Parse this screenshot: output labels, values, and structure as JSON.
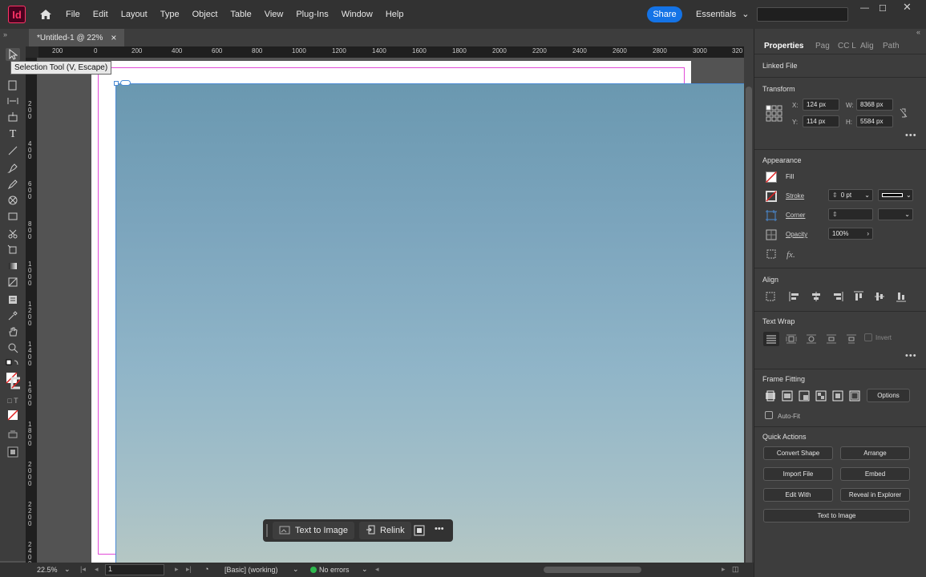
{
  "app": {
    "logo_text": "Id"
  },
  "menu": [
    "File",
    "Edit",
    "Layout",
    "Type",
    "Object",
    "Table",
    "View",
    "Plug-Ins",
    "Window",
    "Help"
  ],
  "header": {
    "share_label": "Share",
    "workspace_label": "Essentials"
  },
  "document": {
    "tab_title": "*Untitled-1 @ 22%",
    "close_glyph": "×"
  },
  "tooltip": "Selection Tool (V, Escape)",
  "ruler": {
    "h_labels": [
      "200",
      "0",
      "200",
      "400",
      "600",
      "800",
      "1000",
      "1200",
      "1400",
      "1600",
      "1800",
      "2000",
      "2200",
      "2400",
      "2600",
      "2800",
      "3000",
      "320"
    ],
    "v_labels": [
      "2 0 0",
      "4 0 0",
      "6 0 0",
      "8 0 0",
      "1 0 0 0",
      "1 2 0 0",
      "1 4 0 0",
      "1 6 0 0",
      "1 8 0 0",
      "2 0 0 0",
      "2 2 0 0",
      "2 4 0 0"
    ]
  },
  "context_bar": {
    "text_to_image": "Text to Image",
    "relink": "Relink",
    "more": "•••"
  },
  "status": {
    "zoom": "22.5%",
    "page": "1",
    "style": "[Basic] (working)",
    "errors": "No errors"
  },
  "panel": {
    "tabs": [
      "Properties",
      "Pag",
      "CC L",
      "Alig",
      "Path"
    ],
    "linked_file": "Linked File",
    "transform": {
      "title": "Transform",
      "x_label": "X:",
      "x": "124 px",
      "y_label": "Y:",
      "y": "114 px",
      "w_label": "W:",
      "w": "8368 px",
      "h_label": "H:",
      "h": "5584 px"
    },
    "appearance": {
      "title": "Appearance",
      "fill": "Fill",
      "stroke": "Stroke",
      "stroke_value": "0 pt",
      "corner": "Corner",
      "opacity": "Opacity",
      "opacity_value": "100%",
      "fx": "fx."
    },
    "align": {
      "title": "Align"
    },
    "text_wrap": {
      "title": "Text Wrap",
      "invert": "Invert"
    },
    "frame_fitting": {
      "title": "Frame Fitting",
      "options": "Options",
      "auto_fit": "Auto-Fit"
    },
    "quick_actions": {
      "title": "Quick Actions",
      "buttons": [
        "Convert Shape",
        "Arrange",
        "Import File",
        "Embed",
        "Edit With",
        "Reveal in Explorer"
      ],
      "text_to_image": "Text to Image"
    },
    "more": "•••"
  },
  "colors": {
    "accent": "#1473e6",
    "margin_guide": "#e24bd8",
    "frame": "#4a8ad4"
  }
}
